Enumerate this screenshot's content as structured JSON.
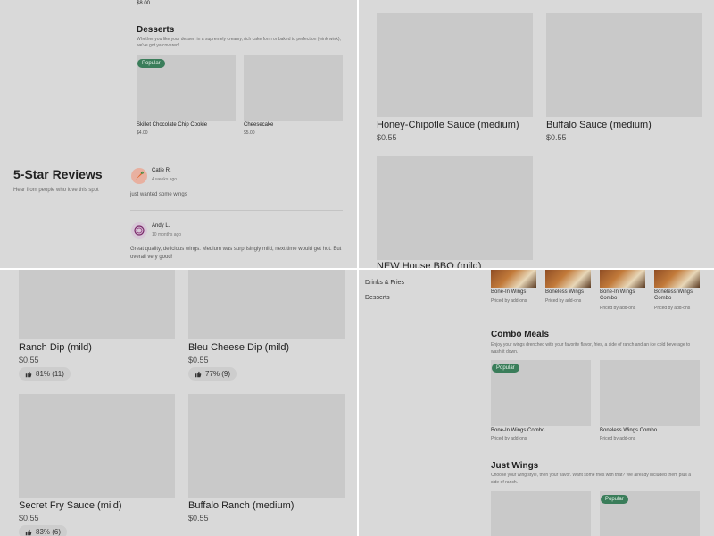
{
  "quad1": {
    "prev_item_price": "$8.00",
    "desserts": {
      "title": "Desserts",
      "description": "Whether you like your dessert in a supremely creamy, rich cake form or baked to perfection (wink wink), we've got ya covered!",
      "items": [
        {
          "name": "Skillet Chocolate Chip Cookie",
          "price": "$4.00",
          "badge": "Popular"
        },
        {
          "name": "Cheesecake",
          "price": "$5.00",
          "badge": ""
        }
      ]
    },
    "reviews": {
      "title": "5-Star Reviews",
      "subtitle": "Hear from people who love this spot",
      "items": [
        {
          "name": "Catie R.",
          "time": "4 weeks ago",
          "text": "just wanted some wings",
          "avatar_icon": "carrot-icon"
        },
        {
          "name": "Andy L.",
          "time": "10 months ago",
          "text": "Great quality, delicious wings. Medium was surprisingly mild, next time would get hot. But overall very good!",
          "avatar_icon": "onion-icon"
        }
      ]
    }
  },
  "quad2": {
    "items": [
      {
        "name": "Honey-Chipotle Sauce (medium)",
        "price": "$0.55"
      },
      {
        "name": "Buffalo Sauce (medium)",
        "price": "$0.55"
      },
      {
        "name": "NEW House BBQ (mild)",
        "price": ""
      }
    ]
  },
  "quad3": {
    "items": [
      {
        "name": "Ranch Dip (mild)",
        "price": "$0.55",
        "rating": "81% (11)"
      },
      {
        "name": "Bleu Cheese Dip (mild)",
        "price": "$0.55",
        "rating": "77% (9)"
      },
      {
        "name": "Secret Fry Sauce (mild)",
        "price": "$0.55",
        "rating": "83% (6)"
      },
      {
        "name": "Buffalo Ranch (medium)",
        "price": "$0.55",
        "rating": ""
      }
    ]
  },
  "quad4": {
    "nav": [
      "Drinks & Fries",
      "Desserts"
    ],
    "categories": [
      {
        "name": "Bone-In Wings",
        "sub": "Priced by add-ons"
      },
      {
        "name": "Boneless Wings",
        "sub": "Priced by add-ons"
      },
      {
        "name": "Bone-In Wings Combo",
        "sub": "Priced by add-ons"
      },
      {
        "name": "Boneless Wings Combo",
        "sub": "Priced by add-ons"
      }
    ],
    "combo": {
      "title": "Combo Meals",
      "description": "Enjoy your wings drenched with your favorite flavor, fries, a side of ranch and an ice cold beverage to wash it down.",
      "items": [
        {
          "name": "Bone-In Wings Combo",
          "sub": "Priced by add-ons",
          "badge": "Popular"
        },
        {
          "name": "Boneless Wings Combo",
          "sub": "Priced by add-ons",
          "badge": ""
        }
      ]
    },
    "just_wings": {
      "title": "Just Wings",
      "description": "Choose your wing style, then your flavor. Want some fries with that? We already included them plus a side of ranch.",
      "badge": "Popular"
    }
  },
  "colors": {
    "overlay_gray": "#d9d9d9",
    "placeholder_gray": "#c9c9c9",
    "popular_badge": "#3a7d5a"
  }
}
